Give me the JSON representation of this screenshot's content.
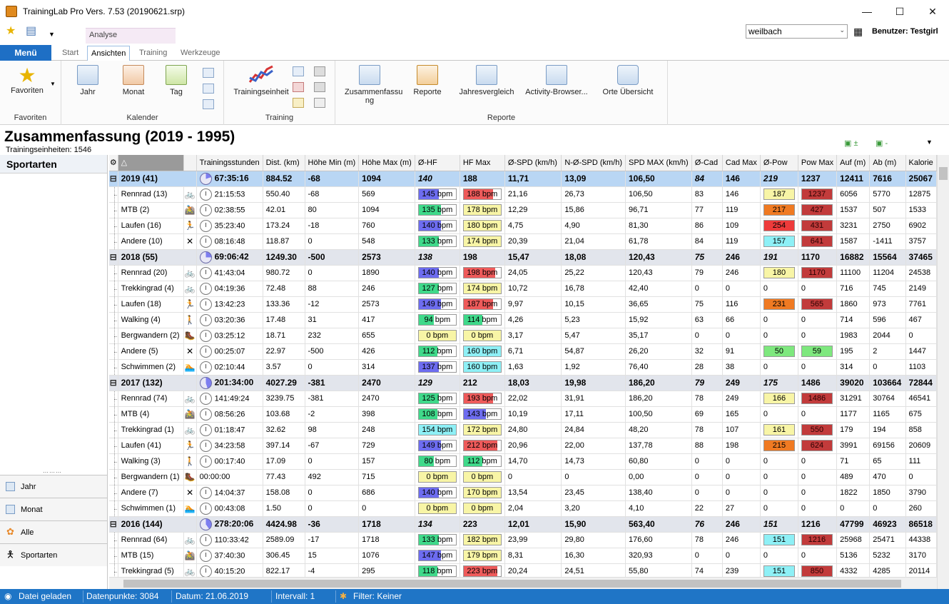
{
  "window": {
    "title": "TrainingLab Pro Vers. 7.53 (20190621.srp)",
    "min": "—",
    "max": "☐",
    "close": "✕"
  },
  "context_tab": "Analyse",
  "search": {
    "value": "weilbach"
  },
  "user_label": "Benutzer: Testgirl",
  "ribbon": {
    "menu": "Menü",
    "tabs": [
      "Start",
      "Ansichten",
      "Training",
      "Werkzeuge"
    ],
    "active_tab": "Ansichten",
    "groups": {
      "favoriten": {
        "title": "Favoriten",
        "button": "Favoriten"
      },
      "kalender": {
        "title": "Kalender",
        "buttons": [
          "Jahr",
          "Monat",
          "Tag"
        ]
      },
      "training": {
        "title": "Training",
        "button": "Trainingseinheit"
      },
      "reporte": {
        "title": "Reporte",
        "buttons": [
          "Zusammenfassu ng",
          "Reporte",
          "Jahresvergleich",
          "Activity-Browser...",
          "Orte Übersicht"
        ]
      }
    }
  },
  "page": {
    "title": "Zusammenfassung (2019 - 1995)",
    "subtitle": "Trainingseinheiten: 1546"
  },
  "left_panel": {
    "title": "Sportarten",
    "nav": [
      "Jahr",
      "Monat",
      "Alle",
      "Sportarten"
    ]
  },
  "grid": {
    "columns": [
      "Trainingsstunden",
      "Dist. (km)",
      "Höhe Min (m)",
      "Höhe Max (m)",
      "Ø-HF",
      "HF Max",
      "Ø-SPD (km/h)",
      "N-Ø-SPD (km/h)",
      "SPD MAX (km/h)",
      "Ø-Cad",
      "Cad Max",
      "Ø-Pow",
      "Pow Max",
      "Auf (m)",
      "Ab (m)",
      "Kalorie"
    ],
    "rows": [
      {
        "type": "group",
        "sel": true,
        "label": "2019  (41)",
        "pie": 0.2,
        "hours": "67:35:16",
        "dist": "884.52",
        "hmin": "-68",
        "hmax": "1094",
        "avghf": "140",
        "hfmax": "188",
        "spd": "11,71",
        "nspd": "13,09",
        "spdmax": "106,50",
        "cad": "84",
        "cadmax": "146",
        "pow": "219",
        "powmax": "1237",
        "auf": "12411",
        "ab": "7616",
        "kal": "25067"
      },
      {
        "type": "sport",
        "label": "Rennrad (13)",
        "icon": "road-bike",
        "hours": "21:15:53",
        "dist": "550.40",
        "hmin": "-68",
        "hmax": "569",
        "avghf": {
          "v": "145 bpm",
          "c": "#6d6cf0",
          "f": 0.55
        },
        "hfmax": {
          "v": "188 bpm",
          "c": "#ee5a5a",
          "f": 0.8
        },
        "spd": "21,16",
        "nspd": "26,73",
        "spdmax": "106,50",
        "cad": "83",
        "cadmax": "146",
        "pow": {
          "v": "187",
          "c": "#f8f5a6"
        },
        "powmax": {
          "v": "1237",
          "c": "#c23b3b"
        },
        "auf": "6056",
        "ab": "5770",
        "kal": "12875"
      },
      {
        "type": "sport",
        "label": "MTB (2)",
        "icon": "mtb",
        "hours": "02:38:55",
        "dist": "42.01",
        "hmin": "80",
        "hmax": "1094",
        "avghf": {
          "v": "135 bpm",
          "c": "#3fd98a",
          "f": 0.6
        },
        "hfmax": {
          "v": "178 bpm",
          "c": "#f8f5a6",
          "f": 1
        },
        "spd": "12,29",
        "nspd": "15,86",
        "spdmax": "96,71",
        "cad": "77",
        "cadmax": "119",
        "pow": {
          "v": "217",
          "c": "#f07a22"
        },
        "powmax": {
          "v": "427",
          "c": "#c23b3b"
        },
        "auf": "1537",
        "ab": "507",
        "kal": "1533"
      },
      {
        "type": "sport",
        "label": "Laufen (16)",
        "icon": "running",
        "hours": "35:23:40",
        "dist": "173.24",
        "hmin": "-18",
        "hmax": "760",
        "avghf": {
          "v": "140 bpm",
          "c": "#6d6cf0",
          "f": 0.6
        },
        "hfmax": {
          "v": "180 bpm",
          "c": "#f8f5a6",
          "f": 1
        },
        "spd": "4,75",
        "nspd": "4,90",
        "spdmax": "81,30",
        "cad": "86",
        "cadmax": "109",
        "pow": {
          "v": "254",
          "c": "#ee3b3b"
        },
        "powmax": {
          "v": "431",
          "c": "#c23b3b"
        },
        "auf": "3231",
        "ab": "2750",
        "kal": "6902"
      },
      {
        "type": "sport",
        "label": "Andere (10)",
        "icon": "other",
        "hours": "08:16:48",
        "dist": "118.87",
        "hmin": "0",
        "hmax": "548",
        "avghf": {
          "v": "133 bpm",
          "c": "#3fd98a",
          "f": 0.55
        },
        "hfmax": {
          "v": "174 bpm",
          "c": "#f8f5a6",
          "f": 1
        },
        "spd": "20,39",
        "nspd": "21,04",
        "spdmax": "61,78",
        "cad": "84",
        "cadmax": "119",
        "pow": {
          "v": "157",
          "c": "#8ef0f6"
        },
        "powmax": {
          "v": "641",
          "c": "#c23b3b"
        },
        "auf": "1587",
        "ab": "-1411",
        "kal": "3757"
      },
      {
        "type": "group",
        "label": "2018  (55)",
        "pie": 0.25,
        "hours": "69:06:42",
        "dist": "1249.30",
        "hmin": "-500",
        "hmax": "2573",
        "avghf": "138",
        "hfmax": "198",
        "spd": "15,47",
        "nspd": "18,08",
        "spdmax": "120,43",
        "cad": "75",
        "cadmax": "246",
        "pow": "191",
        "powmax": "1170",
        "auf": "16882",
        "ab": "15564",
        "kal": "37465"
      },
      {
        "type": "sport",
        "label": "Rennrad (20)",
        "icon": "road-bike",
        "hours": "41:43:04",
        "dist": "980.72",
        "hmin": "0",
        "hmax": "1890",
        "avghf": {
          "v": "140 bpm",
          "c": "#6d6cf0",
          "f": 0.55
        },
        "hfmax": {
          "v": "198 bpm",
          "c": "#ee5a5a",
          "f": 0.85
        },
        "spd": "24,05",
        "nspd": "25,22",
        "spdmax": "120,43",
        "cad": "79",
        "cadmax": "246",
        "pow": {
          "v": "180",
          "c": "#f8f5a6"
        },
        "powmax": {
          "v": "1170",
          "c": "#c23b3b"
        },
        "auf": "11100",
        "ab": "11204",
        "kal": "24538"
      },
      {
        "type": "sport",
        "label": "Trekkingrad (4)",
        "icon": "trekking-bike",
        "hours": "04:19:36",
        "dist": "72.48",
        "hmin": "88",
        "hmax": "246",
        "avghf": {
          "v": "127 bpm",
          "c": "#3fd98a",
          "f": 0.55
        },
        "hfmax": {
          "v": "174 bpm",
          "c": "#f8f5a6",
          "f": 1
        },
        "spd": "10,72",
        "nspd": "16,78",
        "spdmax": "42,40",
        "cad": "0",
        "cadmax": "0",
        "pow": "0",
        "powmax": "0",
        "auf": "716",
        "ab": "745",
        "kal": "2149"
      },
      {
        "type": "sport",
        "label": "Laufen (18)",
        "icon": "running",
        "hours": "13:42:23",
        "dist": "133.36",
        "hmin": "-12",
        "hmax": "2573",
        "avghf": {
          "v": "149 bpm",
          "c": "#6d6cf0",
          "f": 0.6
        },
        "hfmax": {
          "v": "187 bpm",
          "c": "#ee5a5a",
          "f": 0.8
        },
        "spd": "9,97",
        "nspd": "10,15",
        "spdmax": "36,65",
        "cad": "75",
        "cadmax": "116",
        "pow": {
          "v": "231",
          "c": "#f07a22"
        },
        "powmax": {
          "v": "565",
          "c": "#c23b3b"
        },
        "auf": "1860",
        "ab": "973",
        "kal": "7761"
      },
      {
        "type": "sport",
        "label": "Walking (4)",
        "icon": "walking",
        "hours": "03:20:36",
        "dist": "17.48",
        "hmin": "31",
        "hmax": "417",
        "avghf": {
          "v": "94 bpm",
          "c": "#3fd98a",
          "f": 0.4
        },
        "hfmax": {
          "v": "114 bpm",
          "c": "#3fd98a",
          "f": 0.5
        },
        "spd": "4,26",
        "nspd": "5,23",
        "spdmax": "15,92",
        "cad": "63",
        "cadmax": "66",
        "pow": "0",
        "powmax": "0",
        "auf": "714",
        "ab": "596",
        "kal": "467"
      },
      {
        "type": "sport",
        "label": "Bergwandern (2)",
        "icon": "hiking",
        "hours": "03:25:12",
        "dist": "18.71",
        "hmin": "232",
        "hmax": "655",
        "avghf": {
          "v": "0 bpm",
          "c": "#f8f5a6",
          "f": 1
        },
        "hfmax": {
          "v": "0 bpm",
          "c": "#f8f5a6",
          "f": 1
        },
        "spd": "3,17",
        "nspd": "5,47",
        "spdmax": "35,17",
        "cad": "0",
        "cadmax": "0",
        "pow": "0",
        "powmax": "0",
        "auf": "1983",
        "ab": "2044",
        "kal": "0"
      },
      {
        "type": "sport",
        "label": "Andere (5)",
        "icon": "other",
        "hours": "00:25:07",
        "dist": "22.97",
        "hmin": "-500",
        "hmax": "426",
        "avghf": {
          "v": "112 bpm",
          "c": "#3fd98a",
          "f": 0.5
        },
        "hfmax": {
          "v": "160 bpm",
          "c": "#8ef0f6",
          "f": 1
        },
        "spd": "6,71",
        "nspd": "54,87",
        "spdmax": "26,20",
        "cad": "32",
        "cadmax": "91",
        "pow": {
          "v": "50",
          "c": "#7ee87e"
        },
        "powmax": {
          "v": "59",
          "c": "#7ee87e"
        },
        "auf": "195",
        "ab": "2",
        "kal": "1447"
      },
      {
        "type": "sport",
        "label": "Schwimmen (2)",
        "icon": "swimming",
        "hours": "02:10:44",
        "dist": "3.57",
        "hmin": "0",
        "hmax": "314",
        "avghf": {
          "v": "137 bpm",
          "c": "#6d6cf0",
          "f": 0.55
        },
        "hfmax": {
          "v": "160 bpm",
          "c": "#8ef0f6",
          "f": 1
        },
        "spd": "1,63",
        "nspd": "1,92",
        "spdmax": "76,40",
        "cad": "28",
        "cadmax": "38",
        "pow": "0",
        "powmax": "0",
        "auf": "314",
        "ab": "0",
        "kal": "1103"
      },
      {
        "type": "group",
        "label": "2017  (132)",
        "pie": 0.45,
        "hours": "201:34:00",
        "dist": "4027.29",
        "hmin": "-381",
        "hmax": "2470",
        "avghf": "129",
        "hfmax": "212",
        "spd": "18,03",
        "nspd": "19,98",
        "spdmax": "186,20",
        "cad": "79",
        "cadmax": "249",
        "pow": "175",
        "powmax": "1486",
        "auf": "39020",
        "ab": "103664",
        "kal": "72844"
      },
      {
        "type": "sport",
        "label": "Rennrad (74)",
        "icon": "road-bike",
        "hours": "141:49:24",
        "dist": "3239.75",
        "hmin": "-381",
        "hmax": "2470",
        "avghf": {
          "v": "125 bpm",
          "c": "#3fd98a",
          "f": 0.55
        },
        "hfmax": {
          "v": "193 bpm",
          "c": "#ee5a5a",
          "f": 0.8
        },
        "spd": "22,02",
        "nspd": "31,91",
        "spdmax": "186,20",
        "cad": "78",
        "cadmax": "249",
        "pow": {
          "v": "166",
          "c": "#f8f5a6"
        },
        "powmax": {
          "v": "1486",
          "c": "#c23b3b"
        },
        "auf": "31291",
        "ab": "30764",
        "kal": "46541"
      },
      {
        "type": "sport",
        "label": "MTB (4)",
        "icon": "mtb",
        "hours": "08:56:26",
        "dist": "103.68",
        "hmin": "-2",
        "hmax": "398",
        "avghf": {
          "v": "108 bpm",
          "c": "#3fd98a",
          "f": 0.5
        },
        "hfmax": {
          "v": "143 bpm",
          "c": "#6d6cf0",
          "f": 0.6
        },
        "spd": "10,19",
        "nspd": "17,11",
        "spdmax": "100,50",
        "cad": "69",
        "cadmax": "165",
        "pow": "0",
        "powmax": "0",
        "auf": "1177",
        "ab": "1165",
        "kal": "675"
      },
      {
        "type": "sport",
        "label": "Trekkingrad (1)",
        "icon": "trekking-bike",
        "hours": "01:18:47",
        "dist": "32.62",
        "hmin": "98",
        "hmax": "248",
        "avghf": {
          "v": "154 bpm",
          "c": "#8ef0f6",
          "f": 1
        },
        "hfmax": {
          "v": "172 bpm",
          "c": "#f8f5a6",
          "f": 1
        },
        "spd": "24,80",
        "nspd": "24,84",
        "spdmax": "48,20",
        "cad": "78",
        "cadmax": "107",
        "pow": {
          "v": "161",
          "c": "#f8f5a6"
        },
        "powmax": {
          "v": "550",
          "c": "#c23b3b"
        },
        "auf": "179",
        "ab": "194",
        "kal": "858"
      },
      {
        "type": "sport",
        "label": "Laufen (41)",
        "icon": "running",
        "hours": "34:23:58",
        "dist": "397.14",
        "hmin": "-67",
        "hmax": "729",
        "avghf": {
          "v": "149 bpm",
          "c": "#6d6cf0",
          "f": 0.6
        },
        "hfmax": {
          "v": "212 bpm",
          "c": "#ee5a5a",
          "f": 0.9
        },
        "spd": "20,96",
        "nspd": "22,00",
        "spdmax": "137,78",
        "cad": "88",
        "cadmax": "198",
        "pow": {
          "v": "215",
          "c": "#f07a22"
        },
        "powmax": {
          "v": "624",
          "c": "#c23b3b"
        },
        "auf": "3991",
        "ab": "69156",
        "kal": "20609"
      },
      {
        "type": "sport",
        "label": "Walking (3)",
        "icon": "walking",
        "hours": "00:17:40",
        "dist": "17.09",
        "hmin": "0",
        "hmax": "157",
        "avghf": {
          "v": "80 bpm",
          "c": "#3fd98a",
          "f": 0.4
        },
        "hfmax": {
          "v": "112 bpm",
          "c": "#3fd98a",
          "f": 0.5
        },
        "spd": "14,70",
        "nspd": "14,73",
        "spdmax": "60,80",
        "cad": "0",
        "cadmax": "0",
        "pow": "0",
        "powmax": "0",
        "auf": "71",
        "ab": "65",
        "kal": "111"
      },
      {
        "type": "sport",
        "label": "Bergwandern (1)",
        "icon": "hiking",
        "noclock": true,
        "hours": "00:00:00",
        "dist": "77.43",
        "hmin": "492",
        "hmax": "715",
        "avghf": {
          "v": "0 bpm",
          "c": "#f8f5a6",
          "f": 1
        },
        "hfmax": {
          "v": "0 bpm",
          "c": "#f8f5a6",
          "f": 1
        },
        "spd": "0",
        "nspd": "0",
        "spdmax": "0,00",
        "cad": "0",
        "cadmax": "0",
        "pow": "0",
        "powmax": "0",
        "auf": "489",
        "ab": "470",
        "kal": "0"
      },
      {
        "type": "sport",
        "label": "Andere (7)",
        "icon": "other",
        "hours": "14:04:37",
        "dist": "158.08",
        "hmin": "0",
        "hmax": "686",
        "avghf": {
          "v": "140 bpm",
          "c": "#6d6cf0",
          "f": 0.55
        },
        "hfmax": {
          "v": "170 bpm",
          "c": "#f8f5a6",
          "f": 1
        },
        "spd": "13,54",
        "nspd": "23,45",
        "spdmax": "138,40",
        "cad": "0",
        "cadmax": "0",
        "pow": "0",
        "powmax": "0",
        "auf": "1822",
        "ab": "1850",
        "kal": "3790"
      },
      {
        "type": "sport",
        "label": "Schwimmen (1)",
        "icon": "swimming",
        "hours": "00:43:08",
        "dist": "1.50",
        "hmin": "0",
        "hmax": "0",
        "avghf": {
          "v": "0 bpm",
          "c": "#f8f5a6",
          "f": 1
        },
        "hfmax": {
          "v": "0 bpm",
          "c": "#f8f5a6",
          "f": 1
        },
        "spd": "2,04",
        "nspd": "3,20",
        "spdmax": "4,10",
        "cad": "22",
        "cadmax": "27",
        "pow": "0",
        "powmax": "0",
        "auf": "0",
        "ab": "0",
        "kal": "260"
      },
      {
        "type": "group",
        "label": "2016  (144)",
        "pie": 0.4,
        "hours": "278:20:06",
        "dist": "4424.98",
        "hmin": "-36",
        "hmax": "1718",
        "avghf": "134",
        "hfmax": "223",
        "spd": "12,01",
        "nspd": "15,90",
        "spdmax": "563,40",
        "cad": "76",
        "cadmax": "246",
        "pow": "151",
        "powmax": "1216",
        "auf": "47799",
        "ab": "46923",
        "kal": "86518"
      },
      {
        "type": "sport",
        "label": "Rennrad (64)",
        "icon": "road-bike",
        "hours": "110:33:42",
        "dist": "2589.09",
        "hmin": "-17",
        "hmax": "1718",
        "avghf": {
          "v": "133 bpm",
          "c": "#3fd98a",
          "f": 0.55
        },
        "hfmax": {
          "v": "182 bpm",
          "c": "#f8f5a6",
          "f": 1
        },
        "spd": "23,99",
        "nspd": "29,80",
        "spdmax": "176,60",
        "cad": "78",
        "cadmax": "246",
        "pow": {
          "v": "151",
          "c": "#8ef0f6"
        },
        "powmax": {
          "v": "1216",
          "c": "#c23b3b"
        },
        "auf": "25968",
        "ab": "25471",
        "kal": "44338"
      },
      {
        "type": "sport",
        "label": "MTB (15)",
        "icon": "mtb",
        "hours": "37:40:30",
        "dist": "306.45",
        "hmin": "15",
        "hmax": "1076",
        "avghf": {
          "v": "147 bpm",
          "c": "#6d6cf0",
          "f": 0.6
        },
        "hfmax": {
          "v": "179 bpm",
          "c": "#f8f5a6",
          "f": 1
        },
        "spd": "8,31",
        "nspd": "16,30",
        "spdmax": "320,93",
        "cad": "0",
        "cadmax": "0",
        "pow": "0",
        "powmax": "0",
        "auf": "5136",
        "ab": "5232",
        "kal": "3170"
      },
      {
        "type": "sport",
        "label": "Trekkingrad (5)",
        "icon": "trekking-bike",
        "hours": "40:15:20",
        "dist": "822.17",
        "hmin": "-4",
        "hmax": "295",
        "avghf": {
          "v": "118 bpm",
          "c": "#3fd98a",
          "f": 0.5
        },
        "hfmax": {
          "v": "223 bpm",
          "c": "#ee5a5a",
          "f": 0.9
        },
        "spd": "20,24",
        "nspd": "24,51",
        "spdmax": "55,80",
        "cad": "74",
        "cadmax": "239",
        "pow": {
          "v": "151",
          "c": "#8ef0f6"
        },
        "powmax": {
          "v": "850",
          "c": "#c23b3b"
        },
        "auf": "4332",
        "ab": "4285",
        "kal": "20114"
      }
    ]
  },
  "status": {
    "loaded": "Datei geladen",
    "points": "Datenpunkte: 3084",
    "date": "Datum: 21.06.2019",
    "interval": "Intervall: 1",
    "filter": "Filter: Keiner"
  }
}
